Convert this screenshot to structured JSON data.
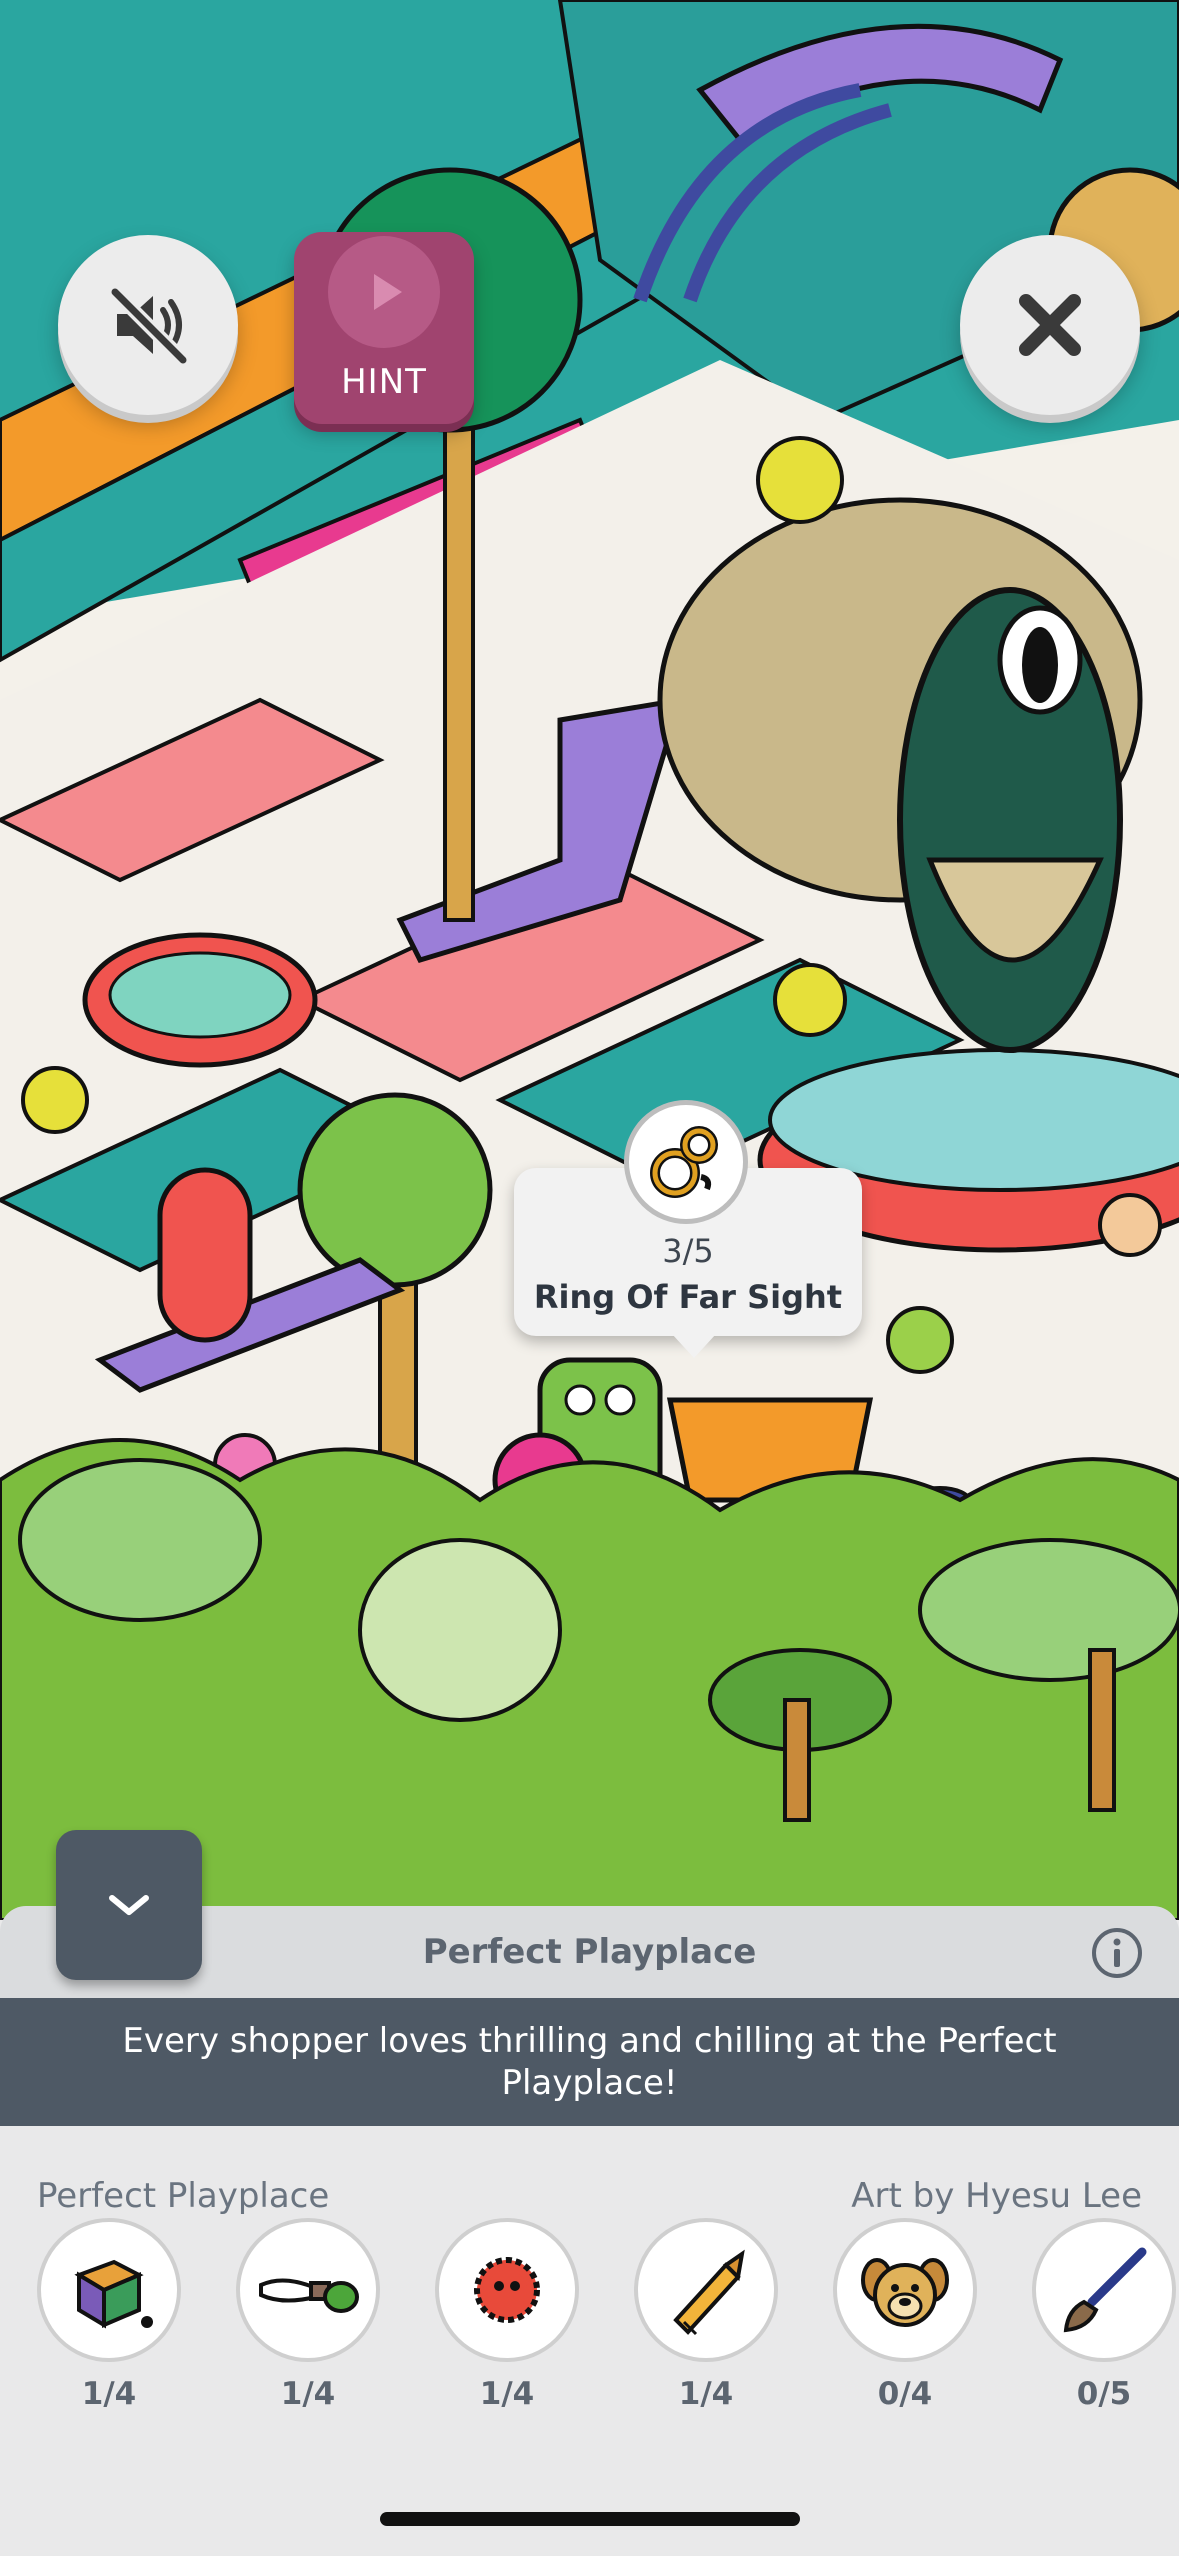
{
  "toolbar": {
    "mute_icon": "speaker-muted-icon",
    "hint_label": "HINT",
    "close_icon": "close-icon"
  },
  "popover": {
    "icon": "ring-icon",
    "count": "3/5",
    "name": "Ring Of Far Sight"
  },
  "sheet": {
    "title": "Perfect Playplace",
    "description": "Every shopper loves thrilling and chilling at the Perfect Playplace!",
    "scene_name": "Perfect Playplace",
    "artist_credit": "Art by Hyesu Lee",
    "items": [
      {
        "icon": "toy-block-icon",
        "count": "1/4"
      },
      {
        "icon": "paintbrush-icon",
        "count": "1/4"
      },
      {
        "icon": "fuzzy-creature-icon",
        "count": "1/4"
      },
      {
        "icon": "crayon-icon",
        "count": "1/4"
      },
      {
        "icon": "dog-face-icon",
        "count": "0/4"
      },
      {
        "icon": "brush-icon",
        "count": "0/5"
      }
    ]
  },
  "colors": {
    "banner": "#4e5965",
    "hint": "#a0446f",
    "grass": "#7cbd3e"
  }
}
